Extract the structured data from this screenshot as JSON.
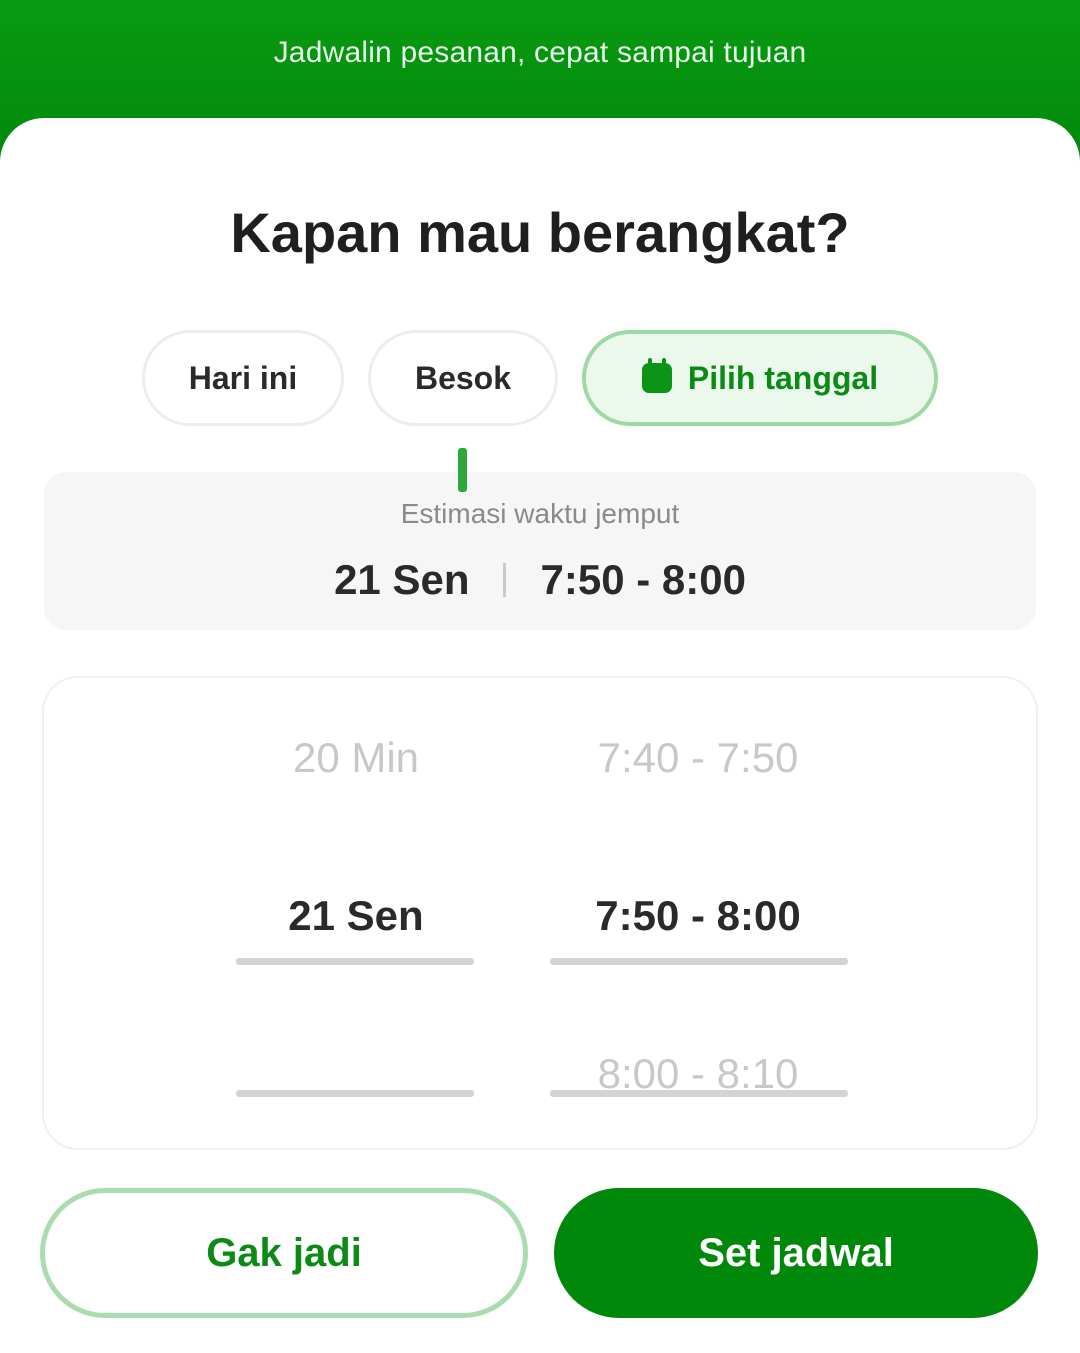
{
  "header": {
    "banner_text": "Jadwalin pesanan, cepat sampai tujuan"
  },
  "dialog": {
    "title": "Kapan mau berangkat?"
  },
  "chips": {
    "today": "Hari ini",
    "tomorrow": "Besok",
    "pick_date": "Pilih tanggal",
    "selected": "pick_date"
  },
  "estimate": {
    "label": "Estimasi waktu jemput",
    "date": "21 Sen",
    "time": "7:50 - 8:00"
  },
  "picker": {
    "date_column": {
      "prev": "20 Min",
      "selected": "21 Sen"
    },
    "time_column": {
      "prev": "7:40 - 7:50",
      "selected": "7:50 - 8:00",
      "next": "8:00 - 8:10"
    }
  },
  "actions": {
    "cancel_label": "Gak jadi",
    "confirm_label": "Set jadwal"
  },
  "colors": {
    "brand_green": "#00880A",
    "accent_light": "#EBF8EC",
    "border_green": "#A9DCAE"
  },
  "icons": {
    "pick_date_icon": "calendar-icon"
  }
}
